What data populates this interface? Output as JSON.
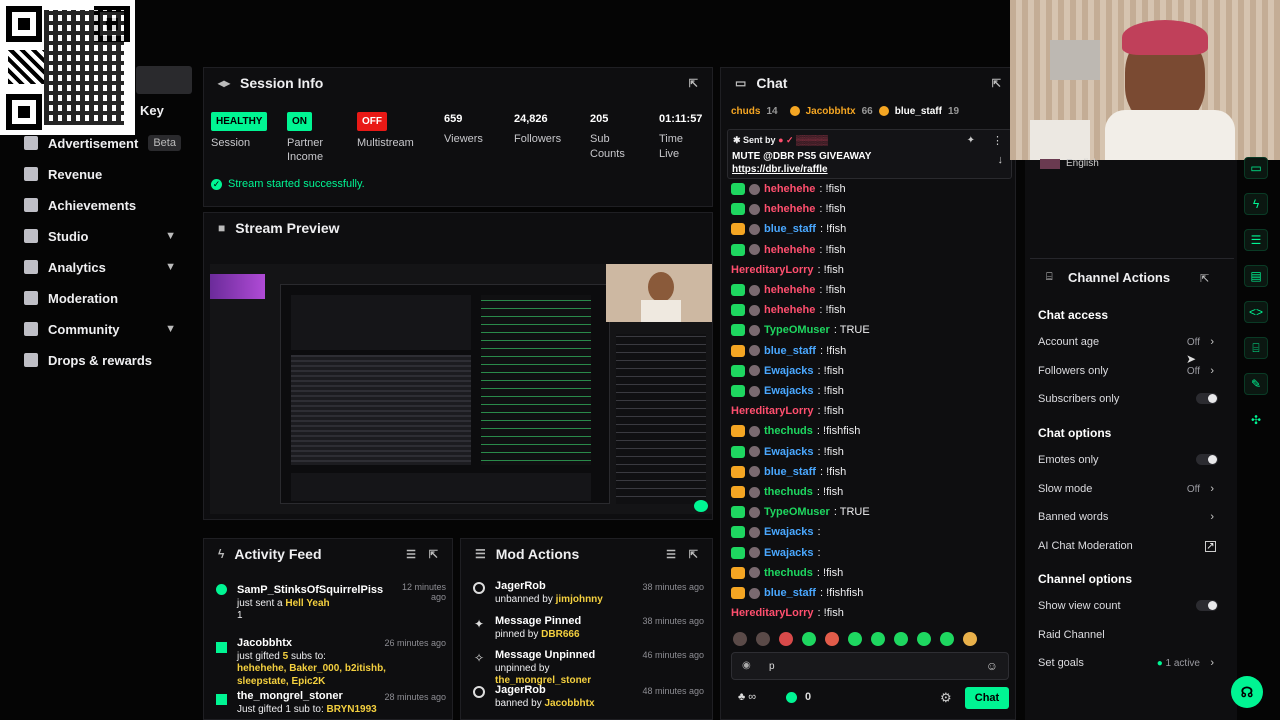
{
  "sidebar": {
    "key_label": "Key",
    "items": [
      {
        "label": "Advertisement",
        "badge": "Beta"
      },
      {
        "label": "Revenue"
      },
      {
        "label": "Achievements"
      },
      {
        "label": "Studio"
      },
      {
        "label": "Analytics"
      },
      {
        "label": "Moderation"
      },
      {
        "label": "Community"
      },
      {
        "label": "Drops & rewards"
      }
    ]
  },
  "session": {
    "title": "Session Info",
    "stats": [
      {
        "badge": "HEALTHY",
        "label": "Session"
      },
      {
        "badge": "ON",
        "label": "Partner Income"
      },
      {
        "badge": "OFF",
        "label": "Multistream"
      },
      {
        "value": "659",
        "label": "Viewers"
      },
      {
        "value": "24,826",
        "label": "Followers"
      },
      {
        "value": "205",
        "label": "Sub Counts"
      },
      {
        "value": "01:11:57",
        "label": "Time Live"
      }
    ],
    "notice": "Stream started successfully."
  },
  "preview": {
    "title": "Stream Preview"
  },
  "chat": {
    "title": "Chat",
    "top_bar": {
      "u1": "chuds",
      "c1": "14",
      "u2": "Jacobbhtx",
      "c2": "66",
      "u3": "blue_staff",
      "c3": "19"
    },
    "pinned": {
      "sent_by": "Sent by",
      "message": "MUTE @DBR PS5 GIVEAWAY",
      "link": "https://dbr.live/raffle"
    },
    "messages": [
      {
        "user": "hehehehe",
        "text": ": !fish",
        "color": "#ff4f6e",
        "badge": "#1ed760"
      },
      {
        "user": "hehehehe",
        "text": ": !fish",
        "color": "#ff4f6e",
        "badge": "#1ed760"
      },
      {
        "user": "blue_staff",
        "text": ": !fish",
        "color": "#4aa8ff",
        "badge": "#f5a623"
      },
      {
        "user": "hehehehe",
        "text": ": !fish",
        "color": "#ff4f6e",
        "badge": "#1ed760"
      },
      {
        "user": "HereditaryLorry",
        "text": ": !fish",
        "color": "#ff4f6e",
        "badge": ""
      },
      {
        "user": "hehehehe",
        "text": ": !fish",
        "color": "#ff4f6e",
        "badge": "#1ed760"
      },
      {
        "user": "hehehehe",
        "text": ": !fish",
        "color": "#ff4f6e",
        "badge": "#1ed760"
      },
      {
        "user": "TypeOMuser",
        "text": ": TRUE",
        "color": "#1ed760",
        "badge": "#1ed760"
      },
      {
        "user": "blue_staff",
        "text": ": !fish",
        "color": "#4aa8ff",
        "badge": "#f5a623"
      },
      {
        "user": "Ewajacks",
        "text": ": !fish",
        "color": "#4aa8ff",
        "badge": "#1ed760"
      },
      {
        "user": "Ewajacks",
        "text": ": !fish",
        "color": "#4aa8ff",
        "badge": "#1ed760"
      },
      {
        "user": "HereditaryLorry",
        "text": ": !fish",
        "color": "#ff4f6e",
        "badge": ""
      },
      {
        "user": "thechuds",
        "text": ": !fishfish",
        "color": "#1ed760",
        "badge": "#f5a623"
      },
      {
        "user": "Ewajacks",
        "text": ": !fish",
        "color": "#4aa8ff",
        "badge": "#1ed760"
      },
      {
        "user": "blue_staff",
        "text": ": !fish",
        "color": "#4aa8ff",
        "badge": "#f5a623"
      },
      {
        "user": "thechuds",
        "text": ": !fish",
        "color": "#1ed760",
        "badge": "#f5a623"
      },
      {
        "user": "TypeOMuser",
        "text": ": TRUE",
        "color": "#1ed760",
        "badge": "#1ed760"
      },
      {
        "user": "Ewajacks",
        "text": ":",
        "color": "#4aa8ff",
        "badge": "#1ed760"
      },
      {
        "user": "Ewajacks",
        "text": ":",
        "color": "#4aa8ff",
        "badge": "#1ed760"
      },
      {
        "user": "thechuds",
        "text": ": !fish",
        "color": "#1ed760",
        "badge": "#f5a623"
      },
      {
        "user": "blue_staff",
        "text": ": !fishfish",
        "color": "#4aa8ff",
        "badge": "#f5a623"
      },
      {
        "user": "HereditaryLorry",
        "text": ": !fish",
        "color": "#ff4f6e",
        "badge": ""
      }
    ],
    "input_value": "p",
    "points": "0",
    "chat_button": "Chat"
  },
  "channel_actions": {
    "title": "Channel Actions",
    "language": "English",
    "chat_access": "Chat access",
    "account_age": "Account age",
    "account_age_val": "Off",
    "followers_only": "Followers only",
    "followers_only_val": "Off",
    "subscribers_only": "Subscribers only",
    "chat_options": "Chat options",
    "emotes_only": "Emotes only",
    "slow_mode": "Slow mode",
    "slow_mode_val": "Off",
    "banned_words": "Banned words",
    "ai_mod": "AI Chat Moderation",
    "channel_options": "Channel options",
    "show_view_count": "Show view count",
    "raid_channel": "Raid Channel",
    "set_goals": "Set goals",
    "set_goals_val": "1 active"
  },
  "activity": {
    "title": "Activity Feed",
    "items": [
      {
        "name": "SamP_StinksOfSquirrelPiss",
        "desc": "just sent a",
        "link": "Hell Yeah",
        "extra": "1",
        "time": "12 minutes ago"
      },
      {
        "name": "Jacobbhtx",
        "desc": "just gifted",
        "link": "5",
        "desc2": "subs to:",
        "targets": "hehehehe, Baker_000, b2itishb, sleepstate, Epic2K",
        "time": "26 minutes ago"
      },
      {
        "name": "the_mongrel_stoner",
        "desc": "Just gifted",
        "link": "1",
        "desc2": "sub to:",
        "targets": "BRYN1993",
        "time": "28 minutes ago"
      }
    ]
  },
  "mod_actions": {
    "title": "Mod Actions",
    "items": [
      {
        "name": "JagerRob",
        "desc": "unbanned by",
        "by": "jimjohnny",
        "time": "38 minutes ago"
      },
      {
        "name": "Message Pinned",
        "desc": "pinned by",
        "by": "DBR666",
        "time": "38 minutes ago"
      },
      {
        "name": "Message Unpinned",
        "desc": "unpinned by",
        "by": "the_mongrel_stoner",
        "time": "46 minutes ago"
      },
      {
        "name": "JagerRob",
        "desc": "banned by",
        "by": "Jacobbhtx",
        "time": "48 minutes ago"
      }
    ]
  },
  "colors": {
    "accent": "#00f593",
    "healthy": "#00f593",
    "off": "#e91916"
  }
}
